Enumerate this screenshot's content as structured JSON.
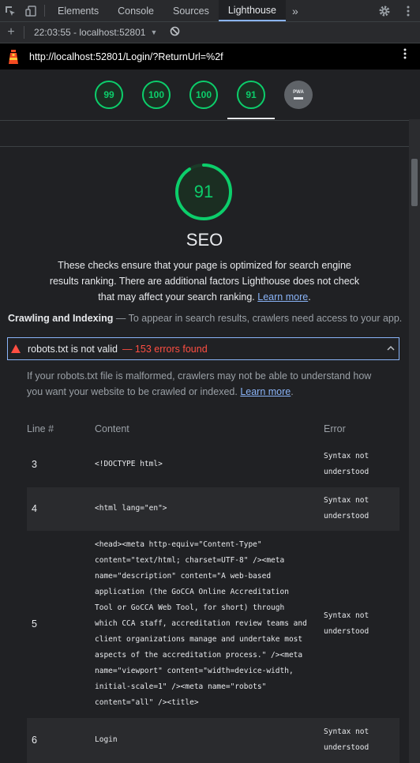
{
  "devtools": {
    "tabs": [
      {
        "label": "Elements"
      },
      {
        "label": "Console"
      },
      {
        "label": "Sources"
      },
      {
        "label": "Lighthouse"
      }
    ],
    "more_label": "»",
    "report_time": "22:03:55 - localhost:52801",
    "active_tab": "Lighthouse"
  },
  "url_bar": {
    "url": "http://localhost:52801/Login/?ReturnUrl=%2f"
  },
  "scores": [
    {
      "value": "99"
    },
    {
      "value": "100"
    },
    {
      "value": "100"
    },
    {
      "value": "91"
    }
  ],
  "pwa_label": "PWA",
  "category": {
    "score": "91",
    "score_value": 91,
    "title": "SEO",
    "description": "These checks ensure that your page is optimized for search engine results ranking. There are additional factors Lighthouse does not check that may affect your search ranking.",
    "learn_more": "Learn more",
    "desc_end": "."
  },
  "group": {
    "title": "Crawling and Indexing",
    "separator": "—",
    "description": "To appear in search results, crawlers need access to your app."
  },
  "audit": {
    "title": "robots.txt is not valid",
    "display_value": "— 153 errors found",
    "description": "If your robots.txt file is malformed, crawlers may not be able to understand how you want your website to be crawled or indexed.",
    "learn_more": "Learn more",
    "desc_end": "."
  },
  "table": {
    "headers": {
      "line": "Line #",
      "content": "Content",
      "error": "Error"
    },
    "rows": [
      {
        "line": "3",
        "content": "<!DOCTYPE html>",
        "error": "Syntax not understood"
      },
      {
        "line": "4",
        "content": "<html lang=\"en\">",
        "error": "Syntax not understood"
      },
      {
        "line": "5",
        "content": "<head><meta http-equiv=\"Content-Type\" content=\"text/html; charset=UTF-8\" /><meta name=\"description\" content=\"A web-based application (the GoCCA Online Accreditation Tool or GoCCA Web Tool, for short) through which CCA staff, accreditation review teams and client organizations manage and undertake most aspects of the accreditation process.\" /><meta name=\"viewport\" content=\"width=device-width, initial-scale=1\" /><meta name=\"robots\" content=\"all\" /><title>",
        "error": "Syntax not understood"
      },
      {
        "line": "6",
        "content": "Login",
        "error": "Syntax not understood"
      }
    ]
  },
  "colors": {
    "pass": "#0cce6b",
    "fail": "#ff4e42",
    "link": "#8ab4f8",
    "background": "#202124"
  },
  "icons": [
    "inspect-icon",
    "device-toggle-icon",
    "settings-gear-icon",
    "more-vertical-icon",
    "plus-icon",
    "dropdown-icon",
    "clear-icon",
    "lighthouse-logo-icon",
    "warning-triangle-icon",
    "chevron-up-icon"
  ]
}
